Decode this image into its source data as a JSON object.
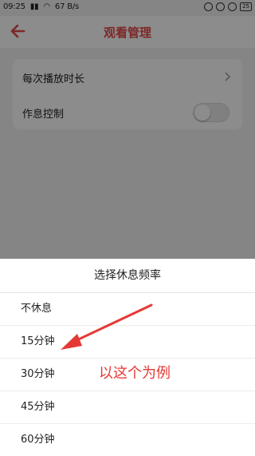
{
  "status_bar": {
    "time": "09:25",
    "network_speed": "67 B/s",
    "battery": "25"
  },
  "header": {
    "back_icon": "back-arrow-icon",
    "title": "观看管理"
  },
  "settings": {
    "items": [
      {
        "label": "每次播放时长",
        "control": "chevron-right-icon"
      },
      {
        "label": "作息控制",
        "control": "toggle",
        "enabled": false
      }
    ]
  },
  "sheet": {
    "title": "选择休息频率",
    "options": [
      "不休息",
      "15分钟",
      "30分钟",
      "45分钟",
      "60分钟"
    ]
  },
  "annotation": {
    "text": "以这个为例",
    "color": "#e53935"
  },
  "colors": {
    "accent": "#e34a4a",
    "overlay": "rgba(0,0,0,0.45)"
  }
}
